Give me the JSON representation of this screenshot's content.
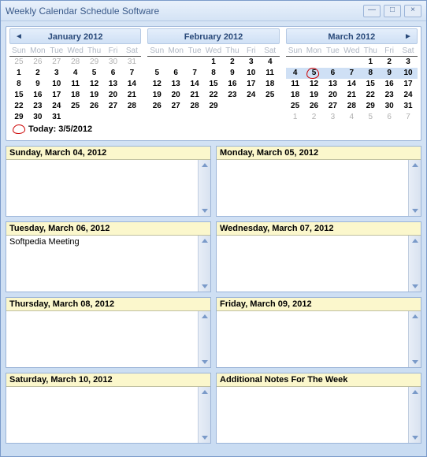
{
  "window": {
    "title": "Weekly Calendar Schedule Software",
    "minimize": "—",
    "maximize": "□",
    "close": "×"
  },
  "nav": {
    "prev": "◄",
    "next": "►"
  },
  "today_line_label": "Today: 3/5/2012",
  "months": [
    {
      "title": "January 2012",
      "dow": [
        "Sun",
        "Mon",
        "Tue",
        "Wed",
        "Thu",
        "Fri",
        "Sat"
      ],
      "weeks": [
        {
          "cells": [
            "25",
            "26",
            "27",
            "28",
            "29",
            "30",
            "31"
          ],
          "grey": [
            true,
            true,
            true,
            true,
            true,
            true,
            true
          ]
        },
        {
          "cells": [
            "1",
            "2",
            "3",
            "4",
            "5",
            "6",
            "7"
          ],
          "grey": [
            false,
            false,
            false,
            false,
            false,
            false,
            false
          ]
        },
        {
          "cells": [
            "8",
            "9",
            "10",
            "11",
            "12",
            "13",
            "14"
          ],
          "grey": [
            false,
            false,
            false,
            false,
            false,
            false,
            false
          ]
        },
        {
          "cells": [
            "15",
            "16",
            "17",
            "18",
            "19",
            "20",
            "21"
          ],
          "grey": [
            false,
            false,
            false,
            false,
            false,
            false,
            false
          ]
        },
        {
          "cells": [
            "22",
            "23",
            "24",
            "25",
            "26",
            "27",
            "28"
          ],
          "grey": [
            false,
            false,
            false,
            false,
            false,
            false,
            false
          ]
        },
        {
          "cells": [
            "29",
            "30",
            "31",
            "",
            "",
            "",
            ""
          ],
          "grey": [
            false,
            false,
            false,
            true,
            true,
            true,
            true
          ]
        }
      ]
    },
    {
      "title": "February 2012",
      "dow": [
        "Sun",
        "Mon",
        "Tue",
        "Wed",
        "Thu",
        "Fri",
        "Sat"
      ],
      "weeks": [
        {
          "cells": [
            "",
            "",
            "",
            "1",
            "2",
            "3",
            "4"
          ],
          "grey": [
            true,
            true,
            true,
            false,
            false,
            false,
            false
          ]
        },
        {
          "cells": [
            "5",
            "6",
            "7",
            "8",
            "9",
            "10",
            "11"
          ],
          "grey": [
            false,
            false,
            false,
            false,
            false,
            false,
            false
          ]
        },
        {
          "cells": [
            "12",
            "13",
            "14",
            "15",
            "16",
            "17",
            "18"
          ],
          "grey": [
            false,
            false,
            false,
            false,
            false,
            false,
            false
          ]
        },
        {
          "cells": [
            "19",
            "20",
            "21",
            "22",
            "23",
            "24",
            "25"
          ],
          "grey": [
            false,
            false,
            false,
            false,
            false,
            false,
            false
          ]
        },
        {
          "cells": [
            "26",
            "27",
            "28",
            "29",
            "",
            "",
            ""
          ],
          "grey": [
            false,
            false,
            false,
            false,
            true,
            true,
            true
          ]
        },
        {
          "cells": [
            "",
            "",
            "",
            "",
            "",
            "",
            ""
          ],
          "grey": [
            true,
            true,
            true,
            true,
            true,
            true,
            true
          ]
        }
      ]
    },
    {
      "title": "March 2012",
      "dow": [
        "Sun",
        "Mon",
        "Tue",
        "Wed",
        "Thu",
        "Fri",
        "Sat"
      ],
      "weeks": [
        {
          "cells": [
            "",
            "",
            "",
            "",
            "1",
            "2",
            "3"
          ],
          "grey": [
            true,
            true,
            true,
            true,
            false,
            false,
            false
          ]
        },
        {
          "cells": [
            "4",
            "5",
            "6",
            "7",
            "8",
            "9",
            "10"
          ],
          "grey": [
            false,
            false,
            false,
            false,
            false,
            false,
            false
          ],
          "selected": true,
          "today_index": 1
        },
        {
          "cells": [
            "11",
            "12",
            "13",
            "14",
            "15",
            "16",
            "17"
          ],
          "grey": [
            false,
            false,
            false,
            false,
            false,
            false,
            false
          ]
        },
        {
          "cells": [
            "18",
            "19",
            "20",
            "21",
            "22",
            "23",
            "24"
          ],
          "grey": [
            false,
            false,
            false,
            false,
            false,
            false,
            false
          ]
        },
        {
          "cells": [
            "25",
            "26",
            "27",
            "28",
            "29",
            "30",
            "31"
          ],
          "grey": [
            false,
            false,
            false,
            false,
            false,
            false,
            false
          ]
        },
        {
          "cells": [
            "1",
            "2",
            "3",
            "4",
            "5",
            "6",
            "7"
          ],
          "grey": [
            true,
            true,
            true,
            true,
            true,
            true,
            true
          ]
        }
      ]
    }
  ],
  "day_boxes": [
    {
      "header": "Sunday, March 04, 2012",
      "text": ""
    },
    {
      "header": "Monday, March 05, 2012",
      "text": ""
    },
    {
      "header": "Tuesday, March 06, 2012",
      "text": "Softpedia Meeting"
    },
    {
      "header": "Wednesday, March 07, 2012",
      "text": ""
    },
    {
      "header": "Thursday, March 08, 2012",
      "text": ""
    },
    {
      "header": "Friday, March 09, 2012",
      "text": ""
    },
    {
      "header": "Saturday, March 10, 2012",
      "text": ""
    },
    {
      "header": "Additional Notes For The Week",
      "text": ""
    }
  ]
}
